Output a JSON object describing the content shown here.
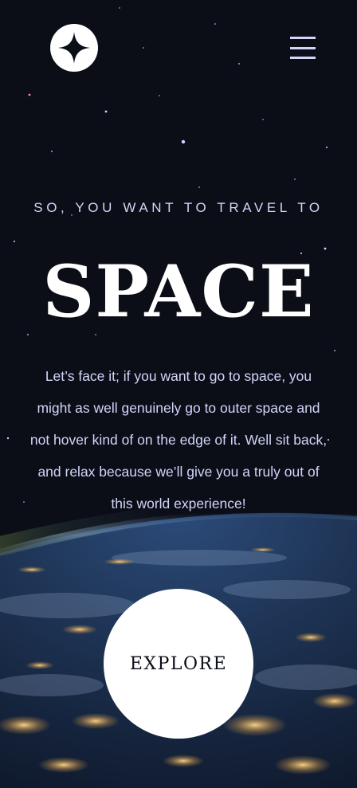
{
  "header": {
    "logo_icon": "star-logo-icon",
    "menu_icon": "hamburger-menu-icon"
  },
  "hero": {
    "eyebrow": "SO, YOU WANT TO TRAVEL TO",
    "title": "SPACE",
    "body": "Let’s face it; if you want to go to space, you might as well genuinely go to outer space and not hover kind of on the edge of it. Well sit back, and relax because we’ll give you a truly out of this world experience!",
    "explore_label": "EXPLORE"
  },
  "colors": {
    "background": "#0b0d17",
    "text_light": "#d0d6f9",
    "white": "#ffffff"
  }
}
